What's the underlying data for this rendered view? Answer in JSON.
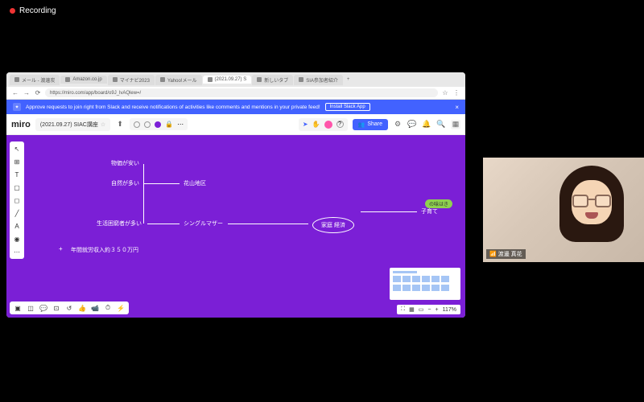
{
  "recording": "Recording",
  "tabs": [
    {
      "label": "メール - 渡邊炭"
    },
    {
      "label": "Amazon.co.jp"
    },
    {
      "label": "マイナビ2023"
    },
    {
      "label": "Yahoo!メール"
    },
    {
      "label": "(2021.09.27) S"
    },
    {
      "label": "新しいタブ"
    },
    {
      "label": "SIA参加者紹介"
    }
  ],
  "url": "https://miro.com/app/board/o9J_lvAQlew=/",
  "banner": {
    "text": "Approve requests to join right from Slack and receive notifications of activities like comments and mentions in your private feed!",
    "btn": "Install Slack App"
  },
  "logo": "miro",
  "board_title": "(2021.09.27) SIAC講座",
  "share": "Share",
  "nodes": {
    "n1": "物価が安い",
    "n2": "自然が多い",
    "n3": "花山地区",
    "n4": "生活困窮者が多い",
    "n5": "シングルマザー",
    "n6": "子育て",
    "n7": "年間就労収入約３５０万円",
    "bubble": "家庭 経済",
    "tag": "の味はき"
  },
  "zoom": "117%",
  "participant": "渡邊 真花"
}
